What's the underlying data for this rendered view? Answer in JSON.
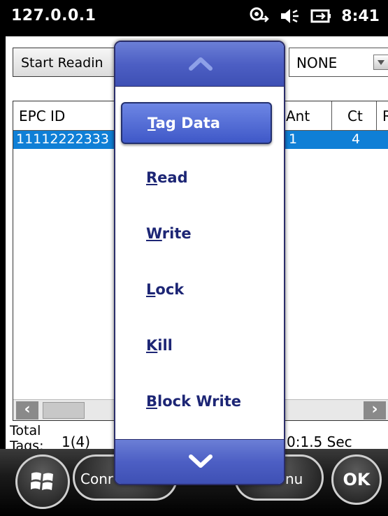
{
  "status_bar": {
    "title": "127.0.0.1",
    "time": "8:41",
    "icons": [
      "connectivity-icon",
      "volume-icon",
      "battery-icon"
    ]
  },
  "toolbar": {
    "start_reading_label": "Start Readin",
    "filter_value": "NONE"
  },
  "grid": {
    "columns": [
      "EPC ID",
      "Ant",
      "Ct",
      "R"
    ],
    "rows": [
      {
        "epc": "11112222333",
        "ant": "1",
        "ct": "4"
      }
    ]
  },
  "footer": {
    "total_label_line1": "Total",
    "total_label_line2": "Tags:",
    "count": "1(4)",
    "time": "0:1.5 Sec"
  },
  "menu": {
    "items": [
      {
        "first": "T",
        "rest": "ag Data",
        "active": true
      },
      {
        "first": "R",
        "rest": "ead",
        "active": false
      },
      {
        "first": "W",
        "rest": "rite",
        "active": false
      },
      {
        "first": "L",
        "rest": "ock",
        "active": false
      },
      {
        "first": "K",
        "rest": "ill",
        "active": false
      },
      {
        "first": "B",
        "rest": "lock Write",
        "active": false
      }
    ]
  },
  "bottom_bar": {
    "left_softkey": "Conr",
    "right_softkey": "nu",
    "ok_label": "OK"
  },
  "colors": {
    "accent": "#0f7fd6",
    "menu_active": "#4a63cc",
    "menu_text": "#1d2675"
  }
}
